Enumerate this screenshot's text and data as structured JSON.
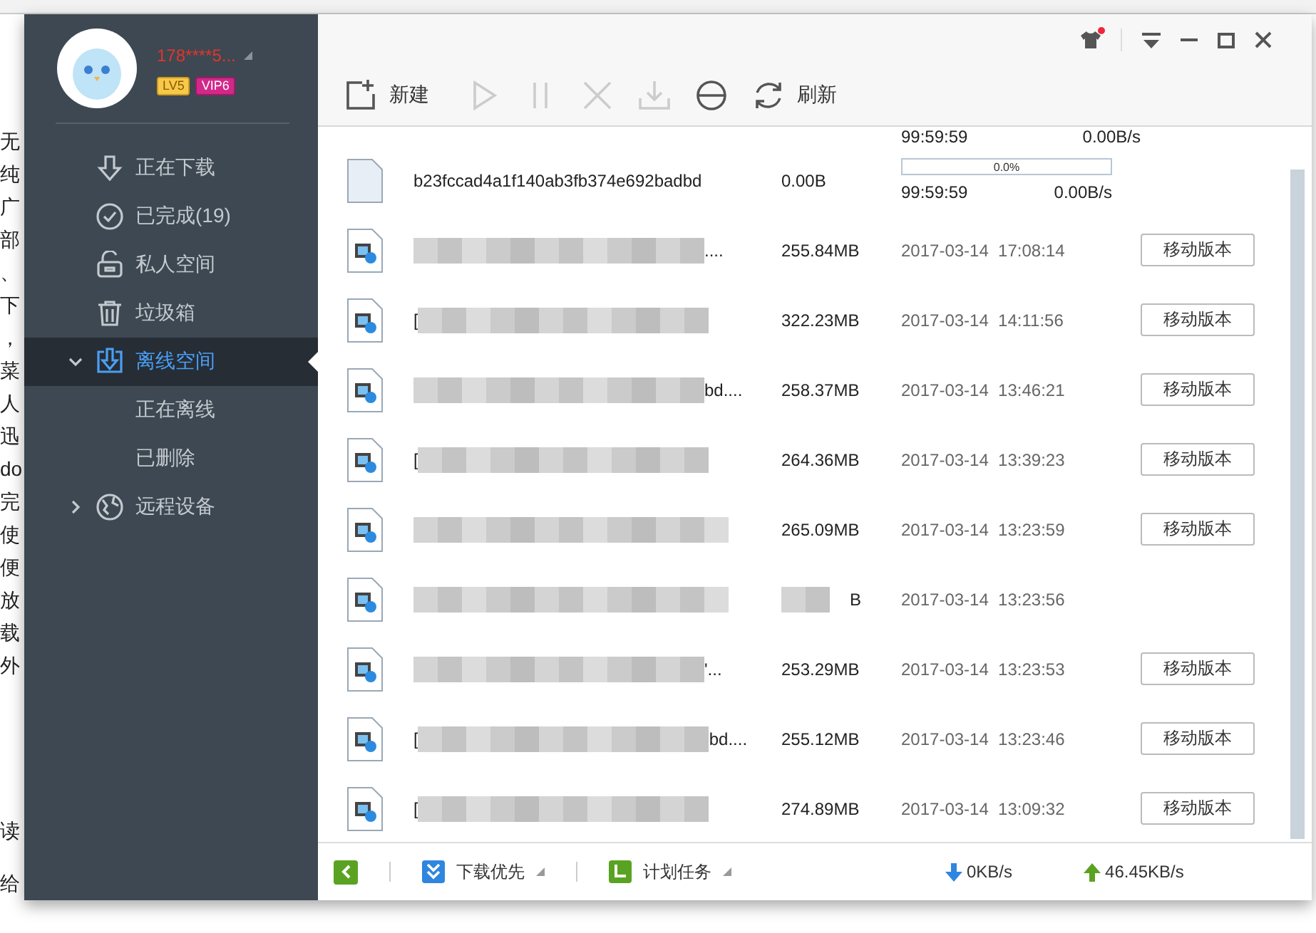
{
  "background_lines": [
    "无",
    "纯",
    "广",
    "部",
    "、",
    "下",
    "，",
    "菜",
    "人",
    "迅",
    "do",
    "完",
    "使",
    "便",
    "放",
    "载",
    "外"
  ],
  "background_footer_lines": [
    "读",
    "给"
  ],
  "user": {
    "name": "178****5...",
    "level_badge": "LV5",
    "vip_badge": "VIP6"
  },
  "nav": [
    {
      "label": "正在下载",
      "selected": false
    },
    {
      "label": "已完成(19)",
      "selected": false
    },
    {
      "label": "私人空间",
      "selected": false
    },
    {
      "label": "垃圾箱",
      "selected": false
    },
    {
      "label": "离线空间",
      "selected": true,
      "expanded": true,
      "children": [
        {
          "label": "正在离线",
          "selected": false
        },
        {
          "label": "已删除",
          "selected": false
        }
      ]
    },
    {
      "label": "远程设备",
      "selected": false,
      "expanded": false
    }
  ],
  "title_bar": {
    "skin_notification": true
  },
  "toolbar": [
    {
      "kind": "new",
      "label": "新建",
      "disabled": false
    },
    {
      "kind": "start",
      "disabled": true
    },
    {
      "kind": "pause",
      "disabled": true
    },
    {
      "kind": "delete",
      "disabled": true
    },
    {
      "kind": "download",
      "disabled": true
    },
    {
      "kind": "browser",
      "disabled": false
    },
    {
      "kind": "refresh",
      "label": "刷新",
      "disabled": false
    }
  ],
  "rows": [
    {
      "kind": "partial",
      "remaining": "99:59:59",
      "speed": "0.00B/s"
    },
    {
      "kind": "downloading",
      "name": "b23fccad4a1f140ab3fb374e692badbd",
      "size": "0.00B",
      "level": 0,
      "progress": "0.0%",
      "remaining": "99:59:59",
      "speed": "0.00B/s"
    },
    {
      "kind": "done",
      "name_end": "....",
      "size": "255.84MB",
      "date": "2017-03-14  17:08:14",
      "action": "移动版本"
    },
    {
      "kind": "done",
      "name_start": "[",
      "size": "322.23MB",
      "date": "2017-03-14  14:11:56",
      "action": "移动版本"
    },
    {
      "kind": "done",
      "name_end": "bd....",
      "size": "258.37MB",
      "date": "2017-03-14  13:46:21",
      "action": "移动版本"
    },
    {
      "kind": "done",
      "name_start": "[",
      "size": "264.36MB",
      "date": "2017-03-14  13:39:23",
      "action": "移动版本"
    },
    {
      "kind": "done",
      "size": "265.09MB",
      "date": "2017-03-14  13:23:59",
      "action": "移动版本"
    },
    {
      "kind": "done",
      "size": "B",
      "size_blurred": true,
      "date": "2017-03-14  13:23:56"
    },
    {
      "kind": "done",
      "name_end": "'...",
      "size": "253.29MB",
      "date": "2017-03-14  13:23:53",
      "action": "移动版本"
    },
    {
      "kind": "done",
      "name_start": "[",
      "name_end": "bd....",
      "size": "255.12MB",
      "date": "2017-03-14  13:23:46",
      "action": "移动版本"
    },
    {
      "kind": "done",
      "name_start": "[",
      "size": "274.89MB",
      "date": "2017-03-14  13:09:32",
      "action": "移动版本"
    }
  ],
  "status_bar": {
    "priority": "下载优先",
    "schedule": "计划任务",
    "download_speed": "0KB/s",
    "upload_speed": "46.45KB/s"
  }
}
